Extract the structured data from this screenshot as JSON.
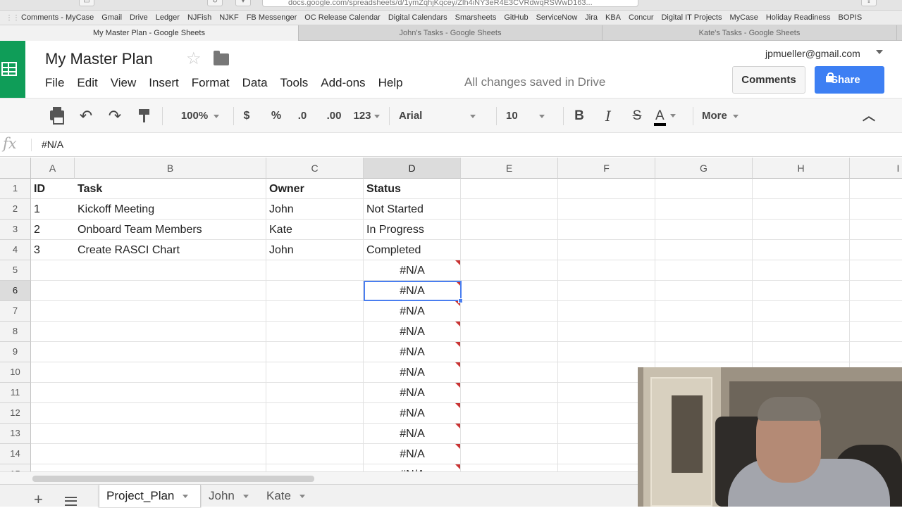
{
  "browser": {
    "url_partial": "docs.google.com/spreadsheets/d/1ymZqhjKqcey/Zlh4iNY3eR4E3CVRdwqRSWwD163...",
    "bookmarks": [
      "Comments - MyCase",
      "Gmail",
      "Drive",
      "Ledger",
      "NJFish",
      "NJKF",
      "FB Messenger",
      "OC Release Calendar",
      "Digital Calendars",
      "Smarsheets",
      "GitHub",
      "ServiceNow",
      "Jira",
      "KBA",
      "Concur",
      "Digital IT Projects",
      "MyCase",
      "Holiday Readiness",
      "BOPIS"
    ],
    "tabs": [
      "My Master Plan - Google Sheets",
      "John's Tasks - Google Sheets",
      "Kate's Tasks - Google Sheets"
    ],
    "active_tab": 0
  },
  "doc": {
    "title": "My Master Plan",
    "menu": [
      "File",
      "Edit",
      "View",
      "Insert",
      "Format",
      "Data",
      "Tools",
      "Add-ons",
      "Help"
    ],
    "save_status": "All changes saved in Drive",
    "account": "jpmueller@gmail.com",
    "comments_label": "Comments",
    "share_label": "Share",
    "brand_color": "#0f9d58",
    "share_color": "#3d7ff3"
  },
  "toolbar": {
    "zoom": "100%",
    "currency": "$",
    "percent": "%",
    "dec_decrease": ".0",
    "dec_increase": ".00",
    "number_format": "123",
    "font": "Arial",
    "font_size": "10",
    "bold": "B",
    "italic": "I",
    "strike": "S",
    "text_color": "A",
    "more": "More",
    "icons": [
      "print-icon",
      "undo-icon",
      "redo-icon",
      "paint-format-icon",
      "collapse-icon"
    ]
  },
  "formula_bar": {
    "fx": "fx",
    "value": "#N/A"
  },
  "grid": {
    "columns": [
      "A",
      "B",
      "C",
      "D",
      "E",
      "F",
      "G",
      "H",
      "I"
    ],
    "selected_column": "D",
    "rows": [
      "1",
      "2",
      "3",
      "4",
      "5",
      "6",
      "7",
      "8",
      "9",
      "10",
      "11",
      "12",
      "13",
      "14",
      "15"
    ],
    "selected_row": "6",
    "header": [
      "ID",
      "Task",
      "Owner",
      "Status"
    ],
    "data": [
      [
        "1",
        "Kickoff Meeting",
        "John",
        "Not Started"
      ],
      [
        "2",
        "Onboard Team Members",
        "Kate",
        "In Progress"
      ],
      [
        "3",
        "Create RASCI Chart",
        "John",
        "Completed"
      ]
    ],
    "error_value": "#N/A",
    "error_rows": 11,
    "note_color": "#c93333",
    "selection_color": "#4a7ef0"
  },
  "sheets": {
    "tabs": [
      "Project_Plan",
      "John",
      "Kate"
    ],
    "active": 0
  }
}
